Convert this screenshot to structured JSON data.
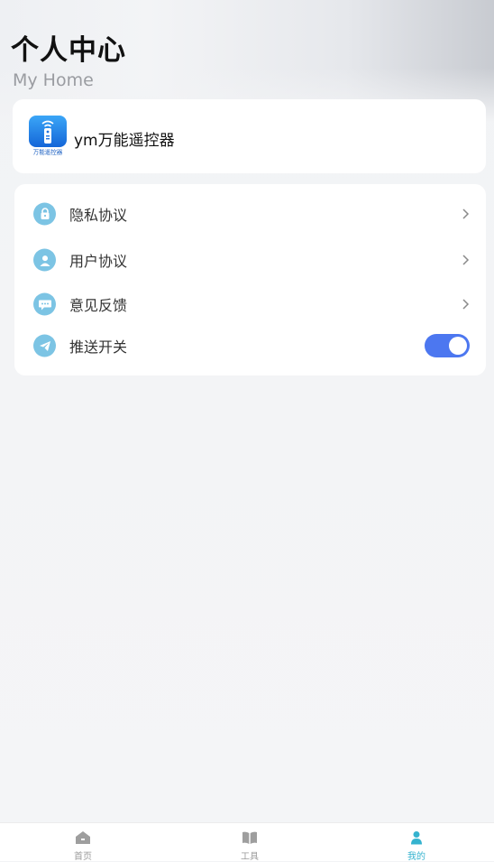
{
  "header": {
    "title": "个人中心",
    "subtitle": "My Home"
  },
  "profile": {
    "app_name": "ym万能遥控器",
    "logo_caption": "万能遥控器",
    "logo_icon": "remote-control-icon"
  },
  "menu": {
    "items": [
      {
        "label": "隐私协议",
        "icon": "lock-icon"
      },
      {
        "label": "用户协议",
        "icon": "user-icon"
      },
      {
        "label": "意见反馈",
        "icon": "chat-bubble-icon"
      },
      {
        "label": "推送开关",
        "icon": "paper-plane-icon"
      }
    ],
    "push_toggle_on": true
  },
  "tabbar": {
    "tabs": [
      {
        "label": "首页",
        "icon": "home-icon",
        "active": false
      },
      {
        "label": "工具",
        "icon": "book-icon",
        "active": false
      },
      {
        "label": "我的",
        "icon": "person-icon",
        "active": true
      }
    ]
  },
  "colors": {
    "accent_toggle": "#4c77f0",
    "icon_bg": "#7cc4e4",
    "tab_active": "#35b3cf"
  }
}
